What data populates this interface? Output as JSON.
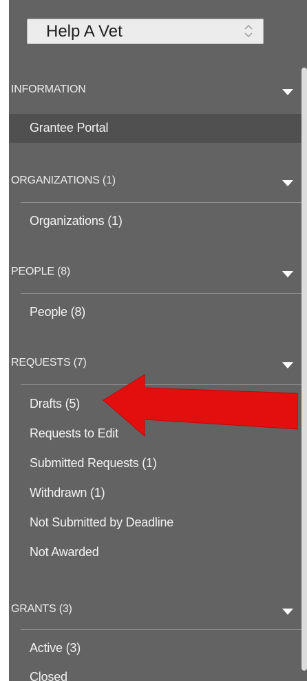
{
  "org_selector": {
    "value": "Help A Vet"
  },
  "sections": {
    "information": {
      "title": "INFORMATION",
      "items": [
        "Grantee Portal"
      ]
    },
    "organizations": {
      "title": "ORGANIZATIONS (1)",
      "items": [
        "Organizations  (1)"
      ]
    },
    "people": {
      "title": "PEOPLE (8)",
      "items": [
        "People  (8)"
      ]
    },
    "requests": {
      "title": "REQUESTS (7)",
      "items": [
        "Drafts  (5)",
        "Requests to Edit",
        "Submitted Requests  (1)",
        "Withdrawn  (1)",
        "Not Submitted by Deadline",
        "Not Awarded"
      ]
    },
    "grants": {
      "title": "GRANTS (3)",
      "items": [
        "Active  (3)",
        "Closed"
      ]
    }
  },
  "colors": {
    "sidebar_bg": "#636363",
    "active_item_bg": "#505050",
    "annotation_arrow": "#e30f0f"
  },
  "icons": {
    "select_arrows": "up-down-chevron-icon",
    "section_toggle": "caret-down-icon",
    "annotation": "red-arrow-annotation"
  }
}
